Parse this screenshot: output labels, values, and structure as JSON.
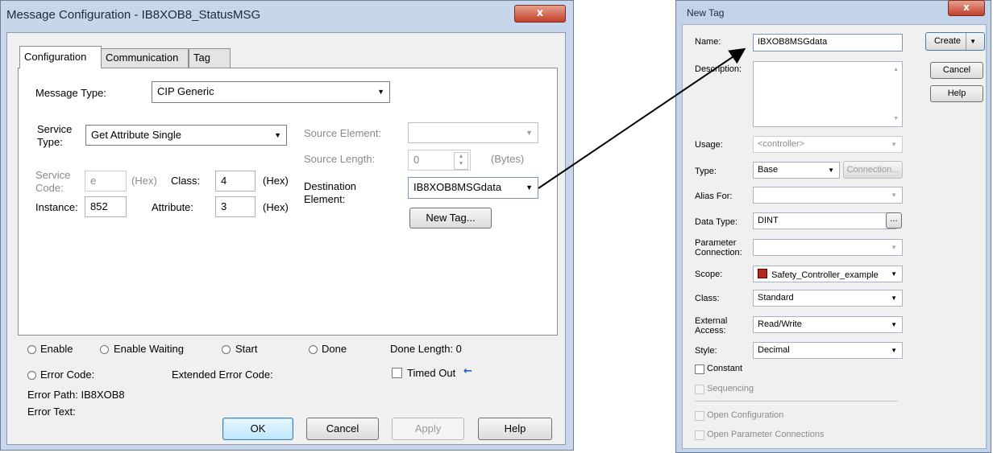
{
  "msg_window": {
    "title": "Message Configuration - IB8XOB8_StatusMSG",
    "close_glyph": "x",
    "tabs": [
      "Configuration",
      "Communication",
      "Tag"
    ],
    "message_type_label": "Message Type:",
    "message_type_value": "CIP Generic",
    "service_type_label_1": "Service",
    "service_type_label_2": "Type:",
    "service_type_value": "Get Attribute Single",
    "service_code_label_1": "Service",
    "service_code_label_2": "Code:",
    "service_code_value": "e",
    "hex_1": "(Hex)",
    "class_label": "Class:",
    "class_value": "4",
    "hex_2": "(Hex)",
    "instance_label": "Instance:",
    "instance_value": "852",
    "attribute_label": "Attribute:",
    "attribute_value": "3",
    "hex_3": "(Hex)",
    "source_element_label": "Source Element:",
    "source_length_label": "Source Length:",
    "source_length_value": "0",
    "bytes_label": "(Bytes)",
    "dest_label_1": "Destination",
    "dest_label_2": "Element:",
    "dest_value": "IB8XOB8MSGdata",
    "new_tag_button": "New Tag...",
    "status": {
      "enable": "Enable",
      "enable_waiting": "Enable Waiting",
      "start": "Start",
      "done": "Done",
      "done_length": "Done Length: 0",
      "error_code": "Error Code:",
      "extended_error_code": "Extended Error Code:",
      "timed_out": "Timed Out",
      "timed_out_arrow": "←",
      "error_path": "Error Path: IB8XOB8",
      "error_text": "Error Text:"
    },
    "buttons": {
      "ok": "OK",
      "cancel": "Cancel",
      "apply": "Apply",
      "help": "Help"
    }
  },
  "new_tag_window": {
    "title": "New Tag",
    "close_glyph": "x",
    "name_label": "Name:",
    "name_value": "IBXOB8MSGdata",
    "description_label": "Description:",
    "usage_label": "Usage:",
    "usage_value": "<controller>",
    "type_label": "Type:",
    "type_value": "Base",
    "connection_button": "Connection...",
    "alias_label": "Alias For:",
    "data_type_label": "Data Type:",
    "data_type_value": "DINT",
    "ellipsis_button": "...",
    "param_conn_label_1": "Parameter",
    "param_conn_label_2": "Connection:",
    "scope_label": "Scope:",
    "scope_value": "Safety_Controller_example",
    "class_label": "Class:",
    "class_value": "Standard",
    "ext_access_label_1": "External",
    "ext_access_label_2": "Access:",
    "ext_access_value": "Read/Write",
    "style_label": "Style:",
    "style_value": "Decimal",
    "constant_label": "Constant",
    "sequencing_label": "Sequencing",
    "open_config_label": "Open Configuration",
    "open_param_label": "Open Parameter Connections",
    "buttons": {
      "create": "Create",
      "cancel": "Cancel",
      "help": "Help"
    }
  },
  "colors": {
    "title_bar": "#c7d6ea",
    "close_red": "#c1402c",
    "arrow": "#000000",
    "timed_out_arrow": "#1f5fbf"
  }
}
